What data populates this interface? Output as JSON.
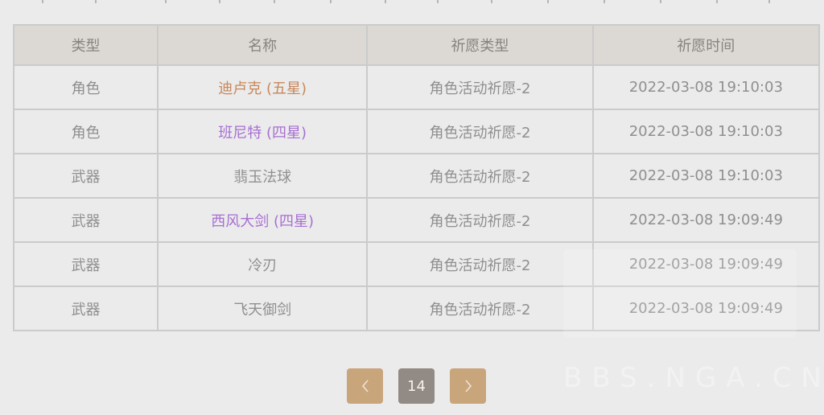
{
  "table": {
    "headers": [
      "类型",
      "名称",
      "祈愿类型",
      "祈愿时间"
    ],
    "rows": [
      {
        "type": "角色",
        "name": "迪卢克 (五星)",
        "rarity": "five",
        "banner": "角色活动祈愿-2",
        "time": "2022-03-08 19:10:03"
      },
      {
        "type": "角色",
        "name": "班尼特 (四星)",
        "rarity": "four",
        "banner": "角色活动祈愿-2",
        "time": "2022-03-08 19:10:03"
      },
      {
        "type": "武器",
        "name": "翡玉法球",
        "rarity": "three",
        "banner": "角色活动祈愿-2",
        "time": "2022-03-08 19:10:03"
      },
      {
        "type": "武器",
        "name": "西风大剑 (四星)",
        "rarity": "four",
        "banner": "角色活动祈愿-2",
        "time": "2022-03-08 19:09:49"
      },
      {
        "type": "武器",
        "name": "冷刃",
        "rarity": "three",
        "banner": "角色活动祈愿-2",
        "time": "2022-03-08 19:09:49"
      },
      {
        "type": "武器",
        "name": "飞天御剑",
        "rarity": "three",
        "banner": "角色活动祈愿-2",
        "time": "2022-03-08 19:09:49"
      }
    ]
  },
  "colors": {
    "five_star": "#c8875a",
    "four_star": "#a76fd3",
    "three_star": "#8f8f8f",
    "pager_button": "#c9a57c",
    "pager_current": "#928a84"
  },
  "pagination": {
    "prev_icon": "chevron-left-icon",
    "current_page": "14",
    "next_icon": "chevron-right-icon"
  },
  "watermark": {
    "text": "BBS.NGA.CN"
  }
}
